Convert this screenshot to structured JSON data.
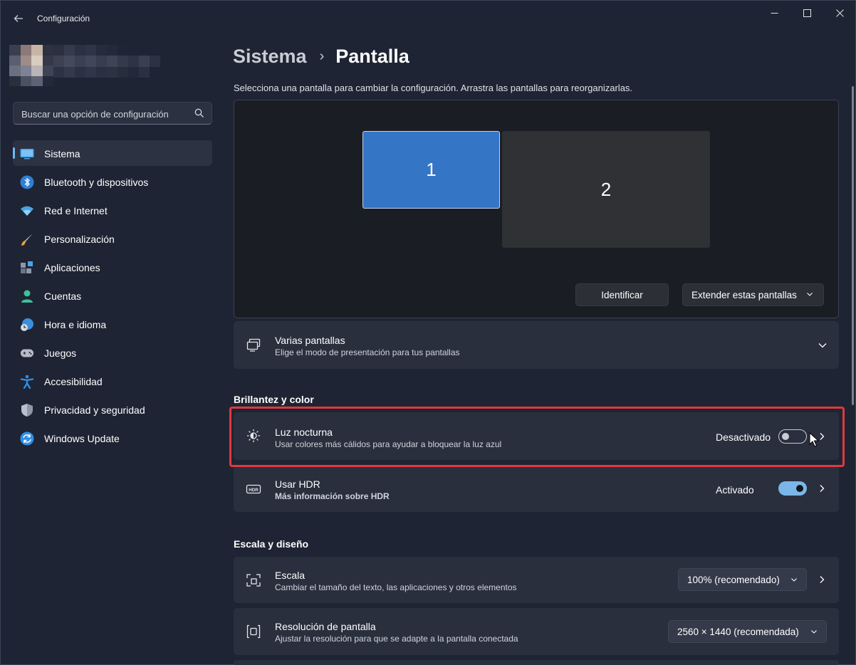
{
  "window": {
    "app_title": "Configuración",
    "controls": {
      "minimize": "—",
      "maximize": "☐",
      "close": "✕"
    }
  },
  "sidebar": {
    "search_placeholder": "Buscar una opción de configuración",
    "items": [
      {
        "label": "Sistema",
        "icon": "system-icon",
        "active": true
      },
      {
        "label": "Bluetooth y dispositivos",
        "icon": "bluetooth-icon"
      },
      {
        "label": "Red e Internet",
        "icon": "wifi-icon"
      },
      {
        "label": "Personalización",
        "icon": "brush-icon"
      },
      {
        "label": "Aplicaciones",
        "icon": "apps-icon"
      },
      {
        "label": "Cuentas",
        "icon": "account-icon"
      },
      {
        "label": "Hora e idioma",
        "icon": "clock-globe-icon"
      },
      {
        "label": "Juegos",
        "icon": "gamepad-icon"
      },
      {
        "label": "Accesibilidad",
        "icon": "accessibility-icon"
      },
      {
        "label": "Privacidad y seguridad",
        "icon": "shield-icon"
      },
      {
        "label": "Windows Update",
        "icon": "update-icon"
      }
    ]
  },
  "main": {
    "breadcrumb": {
      "parent": "Sistema",
      "separator": "›",
      "current": "Pantalla"
    },
    "hint": "Selecciona una pantalla para cambiar la configuración. Arrastra las pantallas para reorganizarlas.",
    "monitors": [
      "1",
      "2"
    ],
    "identify_label": "Identificar",
    "extend_label": "Extender estas pantallas",
    "multi_display": {
      "title": "Varias pantallas",
      "subtitle": "Elige el modo de presentación para tus pantallas"
    },
    "brightness_section": "Brillantez y color",
    "night_light": {
      "title": "Luz nocturna",
      "subtitle": "Usar colores más cálidos para ayudar a bloquear la luz azul",
      "status": "Desactivado",
      "on": false
    },
    "hdr": {
      "title": "Usar HDR",
      "link": "Más información sobre HDR",
      "status": "Activado",
      "on": true
    },
    "scale_section": "Escala y diseño",
    "scale": {
      "title": "Escala",
      "subtitle": "Cambiar el tamaño del texto, las aplicaciones y otros elementos",
      "value": "100% (recomendado)"
    },
    "resolution": {
      "title": "Resolución de pantalla",
      "subtitle": "Ajustar la resolución para que se adapte a la pantalla conectada",
      "value": "2560 × 1440 (recomendada)"
    }
  },
  "colors": {
    "accent": "#3575c6",
    "toggle_on": "#7ab7e8",
    "highlight": "#e0393f",
    "link": "#79c2f2"
  }
}
